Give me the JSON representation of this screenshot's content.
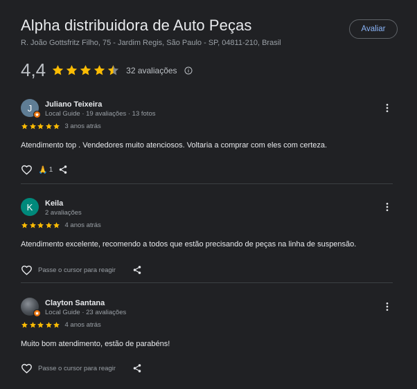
{
  "business": {
    "name": "Alpha distribuidora de Auto Peças",
    "address": "R. João Gottsfritz Filho, 75 - Jardim Regis, São Paulo - SP, 04811-210, Brasil",
    "rate_button": "Avaliar",
    "rating": "4,4",
    "rating_value": 4.4,
    "review_count": "32 avaliações"
  },
  "colors": {
    "star": "#fbbc04",
    "link": "#8ab4f8",
    "background": "#202124"
  },
  "reviews": [
    {
      "avatar_letter": "J",
      "avatar_color": "#5f7d95",
      "local_guide": true,
      "name": "Juliano Teixeira",
      "meta": "Local Guide · 19 avaliações · 13 fotos",
      "stars": 5,
      "time": "3 anos atrás",
      "text": "Atendimento top . Vendedores muito atenciosos. Voltaria a comprar com eles com certeza.",
      "reaction_count": "1"
    },
    {
      "avatar_letter": "K",
      "avatar_color": "#00897b",
      "local_guide": false,
      "name": "Keila",
      "meta": "2 avaliações",
      "stars": 5,
      "time": "4 anos atrás",
      "text": "Atendimento excelente, recomendo a todos que estão precisando de peças na linha de suspensão.",
      "react_hint": "Passe o cursor para reagir"
    },
    {
      "avatar_letter": "",
      "avatar_color": "#4a4f55",
      "local_guide": true,
      "name": "Clayton Santana",
      "meta": "Local Guide · 23 avaliações",
      "stars": 5,
      "time": "4 anos atrás",
      "text": "Muito bom atendimento, estão de parabéns!",
      "react_hint": "Passe o cursor para reagir"
    }
  ]
}
